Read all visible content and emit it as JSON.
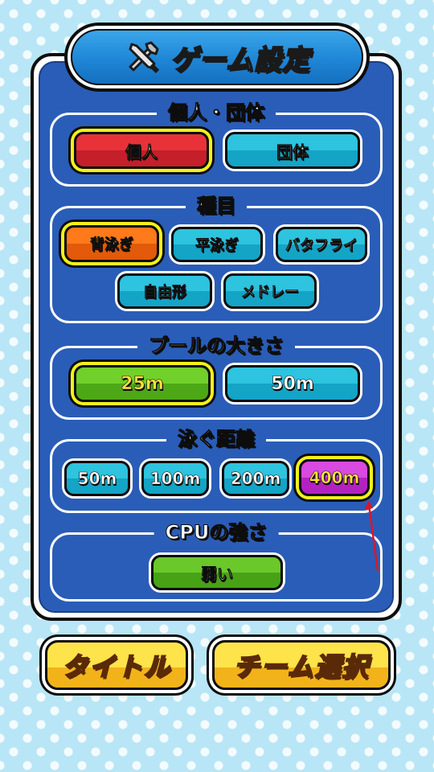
{
  "title": "ゲーム設定",
  "icons": {
    "title": "wrench-screwdriver-icon"
  },
  "sections": {
    "mode": {
      "label": "個人・団体",
      "options": [
        "個人",
        "団体"
      ],
      "selected": "個人"
    },
    "stroke": {
      "label": "種目",
      "options": [
        "背泳ぎ",
        "平泳ぎ",
        "バタフライ",
        "自由形",
        "メドレー"
      ],
      "selected": "背泳ぎ"
    },
    "pool": {
      "label": "プールの大きさ",
      "options": [
        "25m",
        "50m"
      ],
      "selected": "25m"
    },
    "distance": {
      "label": "泳ぐ距離",
      "options": [
        "50m",
        "100m",
        "200m",
        "400m"
      ],
      "selected": "400m"
    },
    "cpu": {
      "label": "CPUの強さ",
      "options": [
        "弱い"
      ],
      "selected": "弱い"
    }
  },
  "buttons": {
    "title": "タイトル",
    "team_select": "チーム選択"
  },
  "colors": {
    "panel_blue": "#2a5db8",
    "teal": "#14a4c6",
    "selected_ring": "#f3f21a",
    "annotation_arrow": "#d8182a"
  }
}
